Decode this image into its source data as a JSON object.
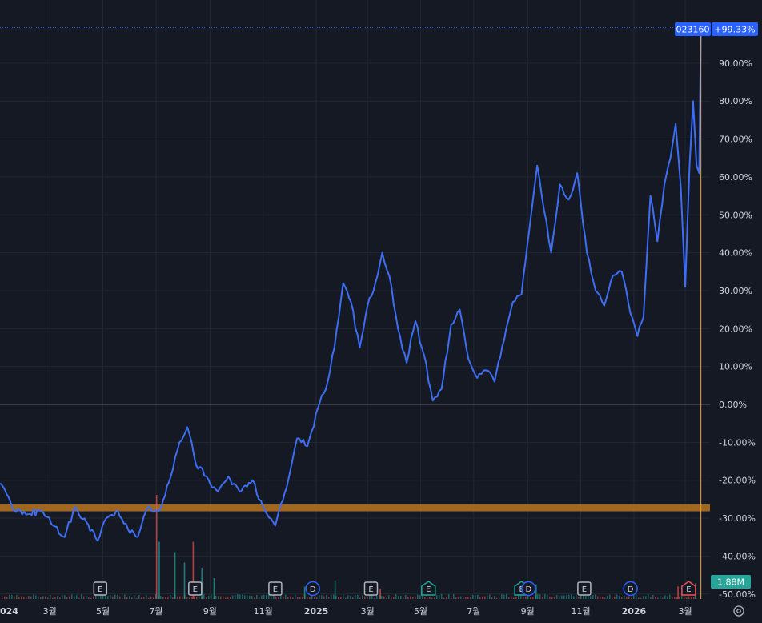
{
  "chart_data": {
    "type": "line",
    "symbol": "023160",
    "current_change": "+99.33%",
    "volume_label": "1.88M",
    "y_unit": "%",
    "ylim": [
      -50,
      100
    ],
    "y_ticks": [
      {
        "value": 90,
        "label": "90.00%"
      },
      {
        "value": 80,
        "label": "80.00%"
      },
      {
        "value": 70,
        "label": "70.00%"
      },
      {
        "value": 60,
        "label": "60.00%"
      },
      {
        "value": 50,
        "label": "50.00%"
      },
      {
        "value": 40,
        "label": "40.00%"
      },
      {
        "value": 30,
        "label": "30.00%"
      },
      {
        "value": 20,
        "label": "20.00%"
      },
      {
        "value": 10,
        "label": "10.00%"
      },
      {
        "value": 0,
        "label": "0.00%"
      },
      {
        "value": -10,
        "label": "-10.00%"
      },
      {
        "value": -20,
        "label": "-20.00%"
      },
      {
        "value": -30,
        "label": "-30.00%"
      },
      {
        "value": -40,
        "label": "-40.00%"
      },
      {
        "value": -50,
        "label": "-50.00%"
      }
    ],
    "x_ticks": [
      {
        "date": "2024-01-01",
        "label": "024",
        "year": true
      },
      {
        "date": "2024-03-01",
        "label": "3월"
      },
      {
        "date": "2024-05-01",
        "label": "5월"
      },
      {
        "date": "2024-07-01",
        "label": "7월"
      },
      {
        "date": "2024-09-01",
        "label": "9월"
      },
      {
        "date": "2024-11-01",
        "label": "11월"
      },
      {
        "date": "2025-01-01",
        "label": "2025",
        "year": true
      },
      {
        "date": "2025-03-01",
        "label": "3월"
      },
      {
        "date": "2025-05-01",
        "label": "5월"
      },
      {
        "date": "2025-07-01",
        "label": "7월"
      },
      {
        "date": "2025-09-01",
        "label": "9월"
      },
      {
        "date": "2025-11-01",
        "label": "11월"
      },
      {
        "date": "2026-01-01",
        "label": "2026",
        "year": true
      },
      {
        "date": "2026-03-01",
        "label": "3월"
      }
    ],
    "series": [
      {
        "line_color": "#3d6ef5",
        "points": [
          [
            "2023-12-20",
            -18
          ],
          [
            "2024-01-05",
            -21
          ],
          [
            "2024-01-20",
            -28
          ],
          [
            "2024-02-05",
            -29
          ],
          [
            "2024-02-20",
            -28
          ],
          [
            "2024-03-05",
            -32
          ],
          [
            "2024-03-18",
            -35
          ],
          [
            "2024-03-30",
            -27
          ],
          [
            "2024-04-12",
            -31
          ],
          [
            "2024-04-25",
            -36
          ],
          [
            "2024-05-05",
            -30
          ],
          [
            "2024-05-18",
            -28
          ],
          [
            "2024-05-30",
            -33
          ],
          [
            "2024-06-10",
            -35
          ],
          [
            "2024-06-22",
            -27
          ],
          [
            "2024-07-05",
            -28
          ],
          [
            "2024-07-18",
            -19
          ],
          [
            "2024-07-28",
            -10
          ],
          [
            "2024-08-06",
            -6
          ],
          [
            "2024-08-16",
            -16
          ],
          [
            "2024-08-28",
            -19
          ],
          [
            "2024-09-10",
            -23
          ],
          [
            "2024-09-22",
            -19
          ],
          [
            "2024-10-05",
            -23
          ],
          [
            "2024-10-20",
            -20
          ],
          [
            "2024-11-01",
            -27
          ],
          [
            "2024-11-15",
            -32
          ],
          [
            "2024-11-28",
            -22
          ],
          [
            "2024-12-10",
            -9
          ],
          [
            "2024-12-22",
            -11
          ],
          [
            "2025-01-03",
            -1
          ],
          [
            "2025-01-12",
            4
          ],
          [
            "2025-01-22",
            15
          ],
          [
            "2025-02-01",
            32
          ],
          [
            "2025-02-10",
            27
          ],
          [
            "2025-02-20",
            15
          ],
          [
            "2025-03-01",
            26
          ],
          [
            "2025-03-10",
            32
          ],
          [
            "2025-03-18",
            40
          ],
          [
            "2025-03-26",
            34
          ],
          [
            "2025-04-05",
            20
          ],
          [
            "2025-04-15",
            11
          ],
          [
            "2025-04-25",
            22
          ],
          [
            "2025-05-05",
            13
          ],
          [
            "2025-05-15",
            1
          ],
          [
            "2025-05-25",
            4
          ],
          [
            "2025-06-05",
            21
          ],
          [
            "2025-06-15",
            25
          ],
          [
            "2025-06-25",
            12
          ],
          [
            "2025-07-05",
            7
          ],
          [
            "2025-07-15",
            9
          ],
          [
            "2025-07-25",
            6
          ],
          [
            "2025-08-05",
            17
          ],
          [
            "2025-08-15",
            27
          ],
          [
            "2025-08-25",
            29
          ],
          [
            "2025-09-05",
            50
          ],
          [
            "2025-09-12",
            63
          ],
          [
            "2025-09-20",
            51
          ],
          [
            "2025-09-28",
            40
          ],
          [
            "2025-10-08",
            58
          ],
          [
            "2025-10-18",
            54
          ],
          [
            "2025-10-28",
            61
          ],
          [
            "2025-11-08",
            40
          ],
          [
            "2025-11-18",
            30
          ],
          [
            "2025-11-28",
            26
          ],
          [
            "2025-12-08",
            34
          ],
          [
            "2025-12-18",
            35
          ],
          [
            "2025-12-28",
            24
          ],
          [
            "2026-01-05",
            18
          ],
          [
            "2026-01-12",
            23
          ],
          [
            "2026-01-20",
            55
          ],
          [
            "2026-01-28",
            43
          ],
          [
            "2026-02-05",
            58
          ],
          [
            "2026-02-12",
            65
          ],
          [
            "2026-02-18",
            74
          ],
          [
            "2026-02-24",
            57
          ],
          [
            "2026-03-01",
            31
          ],
          [
            "2026-03-06",
            63
          ],
          [
            "2026-03-10",
            80
          ],
          [
            "2026-03-14",
            63
          ],
          [
            "2026-03-17",
            61
          ],
          [
            "2026-03-19",
            99.33
          ]
        ]
      }
    ],
    "overlays": {
      "support_band": {
        "low": -28.2,
        "high": -26.4,
        "color": "#b8761d"
      },
      "zero_line": 0
    },
    "event_markers": [
      {
        "date": "2023-12-22",
        "label": "D",
        "kind": "dividend"
      },
      {
        "date": "2024-04-28",
        "label": "E",
        "kind": "earnings"
      },
      {
        "date": "2024-08-15",
        "label": "E",
        "kind": "earnings"
      },
      {
        "date": "2024-11-15",
        "label": "E",
        "kind": "earnings"
      },
      {
        "date": "2024-12-28",
        "label": "D",
        "kind": "dividend"
      },
      {
        "date": "2025-03-05",
        "label": "E",
        "kind": "earnings"
      },
      {
        "date": "2025-05-10",
        "label": "E",
        "kind": "earnings-positive"
      },
      {
        "date": "2025-08-25",
        "label": "E",
        "kind": "earnings-positive"
      },
      {
        "date": "2025-09-02",
        "label": "D",
        "kind": "dividend"
      },
      {
        "date": "2025-11-05",
        "label": "E",
        "kind": "earnings"
      },
      {
        "date": "2025-12-28",
        "label": "D",
        "kind": "dividend"
      },
      {
        "date": "2026-03-05",
        "label": "E",
        "kind": "earnings-negative"
      }
    ],
    "volume": [
      {
        "date": "2024-07-01",
        "v": 1.0,
        "up": false
      },
      {
        "date": "2024-07-04",
        "v": 0.55,
        "up": true
      },
      {
        "date": "2024-07-22",
        "v": 0.45,
        "up": true
      },
      {
        "date": "2024-08-12",
        "v": 0.55,
        "up": false
      },
      {
        "date": "2024-08-02",
        "v": 0.35,
        "up": true
      },
      {
        "date": "2024-08-22",
        "v": 0.3,
        "up": true
      },
      {
        "date": "2024-09-05",
        "v": 0.2,
        "up": true
      },
      {
        "date": "2024-12-18",
        "v": 0.12,
        "up": true
      },
      {
        "date": "2025-01-22",
        "v": 0.18,
        "up": true
      },
      {
        "date": "2025-03-15",
        "v": 0.1,
        "up": false
      },
      {
        "date": "2025-09-10",
        "v": 0.14,
        "up": true
      },
      {
        "date": "2026-02-20",
        "v": 0.12,
        "up": false
      },
      {
        "date": "2026-03-12",
        "v": 0.15,
        "up": true
      }
    ],
    "grid": true,
    "colors": {
      "background": "#151924",
      "grid": "#222734",
      "up": "#26a69a",
      "down": "#ef5350",
      "accent_blue": "#2962ff",
      "crosshair": "#f5a623",
      "dividend": "#2962ff"
    }
  }
}
